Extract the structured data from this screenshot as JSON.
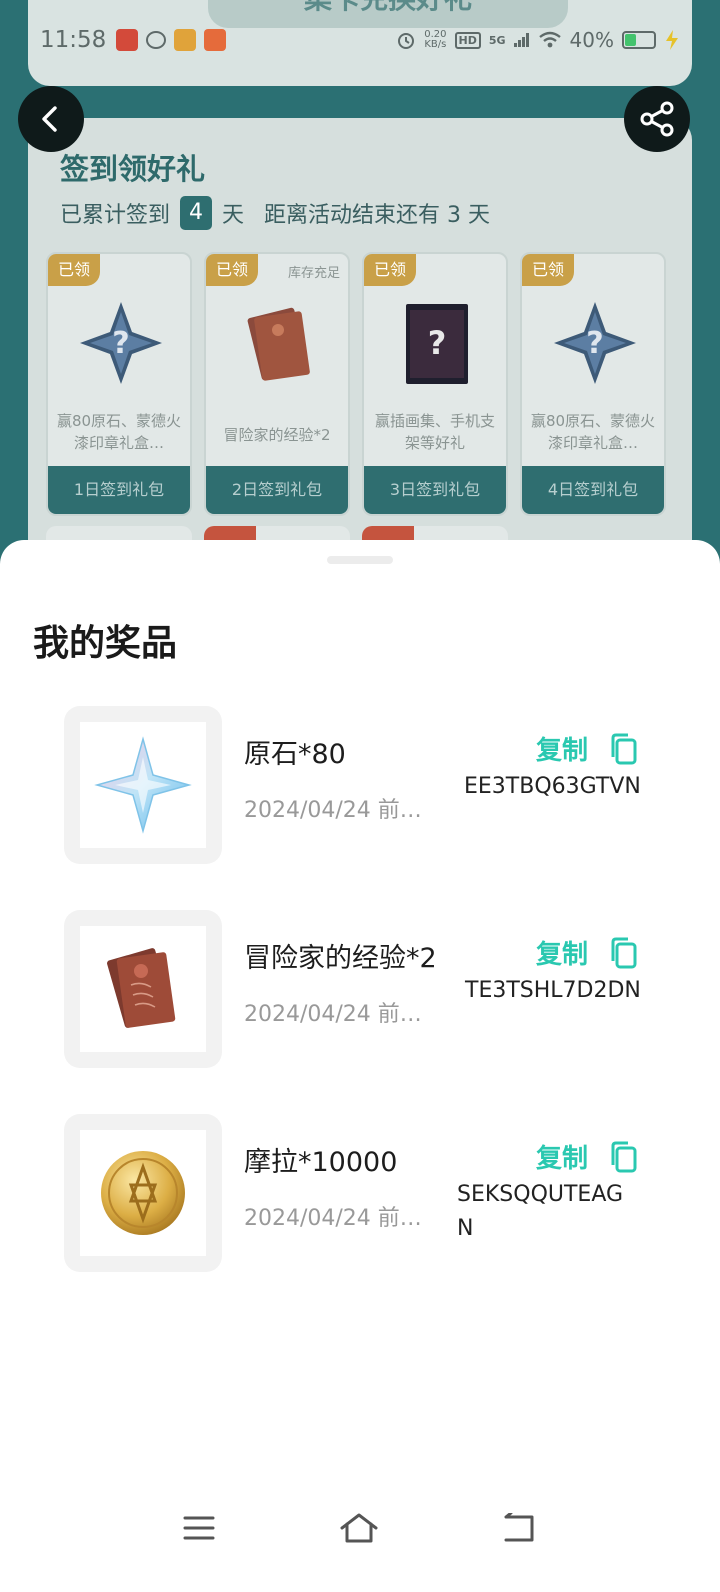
{
  "status_bar": {
    "time": "11:58",
    "net_speed": "0.20\nKB/s",
    "signal": "5G",
    "battery_pct": "40%",
    "battery_level": 0.4
  },
  "background_page": {
    "top_button_label": "集卡兑换好礼",
    "section_title": "签到领好礼",
    "signed_prefix": "已累计签到",
    "signed_days": "4",
    "signed_suffix": "天",
    "remaining_text": "距离活动结束还有 3 天",
    "gifts": [
      {
        "tag": "已领",
        "stock": "",
        "desc": "赢80原石、蒙德火漆印章礼盒…",
        "button": "1日签到礼包"
      },
      {
        "tag": "已领",
        "stock": "库存充足",
        "desc": "冒险家的经验*2",
        "button": "2日签到礼包"
      },
      {
        "tag": "已领",
        "stock": "",
        "desc": "赢插画集、手机支架等好礼",
        "button": "3日签到礼包"
      },
      {
        "tag": "已领",
        "stock": "",
        "desc": "赢80原石、蒙德火漆印章礼盒…",
        "button": "4日签到礼包"
      }
    ]
  },
  "sheet": {
    "title": "我的奖品",
    "copy_label": "复制",
    "prizes": [
      {
        "name": "原石*80",
        "date": "2024/04/24 前…",
        "code": "EE3TBQ63GTVN",
        "icon": "primogem-icon"
      },
      {
        "name": "冒险家的经验*2",
        "date": "2024/04/24 前…",
        "code": "TE3TSHL7D2DN",
        "icon": "adventurer-exp-icon"
      },
      {
        "name": "摩拉*10000",
        "date": "2024/04/24 前…",
        "code": "SEKSQQUTEAGN",
        "icon": "mora-coin-icon"
      }
    ]
  },
  "colors": {
    "accent": "#2ac8b0",
    "bg_page": "#2b7073",
    "sheet_bg": "#ffffff"
  }
}
